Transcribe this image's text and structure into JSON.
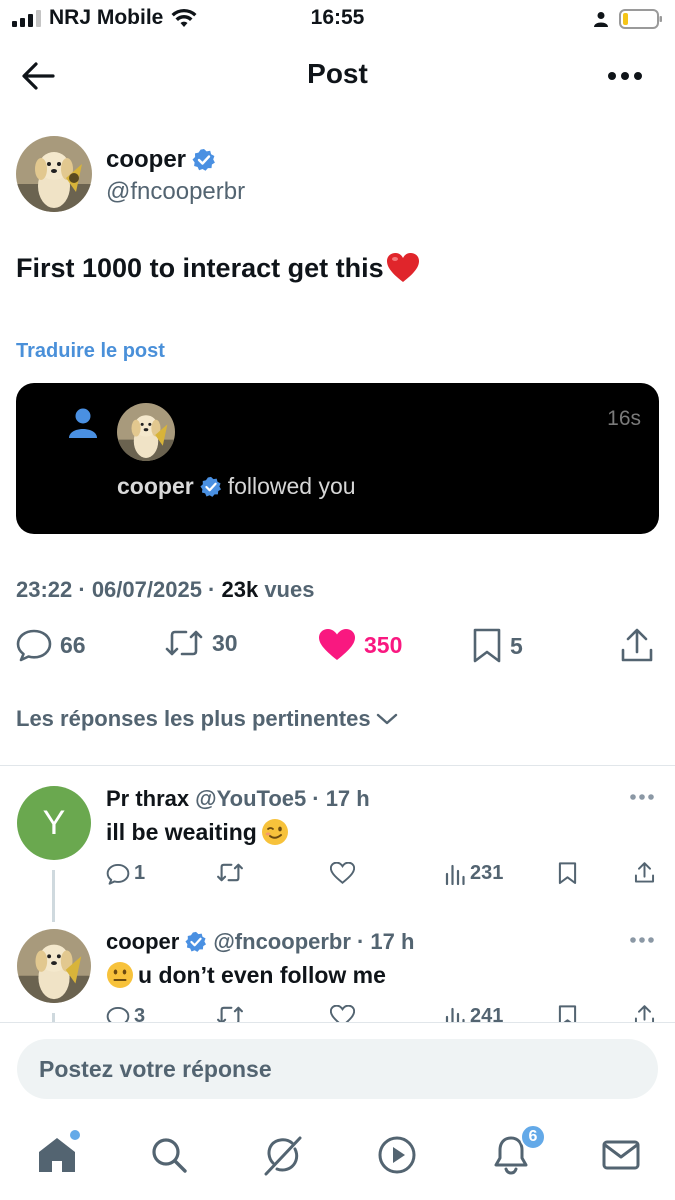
{
  "status_bar": {
    "carrier": "NRJ Mobile",
    "time": "16:55"
  },
  "header": {
    "title": "Post"
  },
  "post": {
    "author_name": "cooper",
    "author_handle": "@fncooperbr",
    "text": "First 1000 to interact get this",
    "translate_label": "Traduire le post",
    "embed": {
      "name": "cooper",
      "action_text": "followed you",
      "time": "16s"
    },
    "timestamp": "23:22 · 06/07/2025 · ",
    "views_count": "23k",
    "views_label": " vues",
    "stats": {
      "replies": "66",
      "reposts": "30",
      "likes": "350",
      "bookmarks": "5"
    }
  },
  "sort_label": "Les réponses les plus pertinentes",
  "replies": [
    {
      "avatar_letter": "Y",
      "name": "Pr thrax",
      "handle": "@YouToe5",
      "time": "· 17 h",
      "text": "ill be weaiting",
      "replies": "1",
      "reposts": "",
      "likes": "",
      "views": "231"
    },
    {
      "name": "cooper",
      "handle": "@fncooperbr",
      "time": "· 17 h",
      "text": "u don’t even follow me",
      "replies": "3",
      "reposts": "",
      "likes": "",
      "views": "241"
    }
  ],
  "composer": {
    "placeholder": "Postez votre réponse"
  },
  "tabbar": {
    "notifications_badge": "6"
  },
  "colors": {
    "accent": "#1d9bf0",
    "like": "#f91880",
    "secondary_text": "#536471",
    "translate_link": "#4a90d9"
  }
}
